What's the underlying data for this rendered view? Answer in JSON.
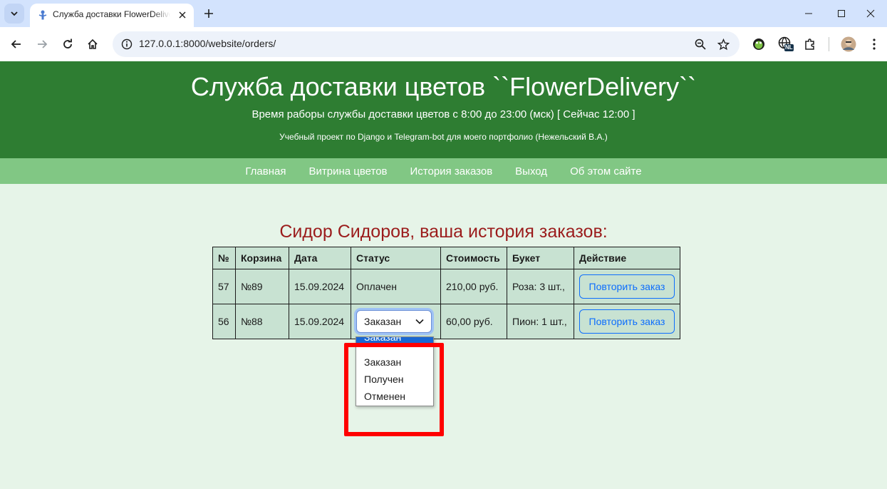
{
  "browser": {
    "tab_title": "Служба доставки FlowerDelivery",
    "url": "127.0.0.1:8000/website/orders/",
    "extension_badge": "NL"
  },
  "header": {
    "title": "Служба доставки цветов ``FlowerDelivery``",
    "hours": "Время раборы службы доставки цветов с 8:00 до 23:00 (мск) [ Сейчас 12:00 ]",
    "note": "Учебный проект по Django и Telegram-bot для моего портфолио (Нежельский В.А.)"
  },
  "nav": {
    "items": [
      "Главная",
      "Витрина цветов",
      "История заказов",
      "Выход",
      "Об этом сайте"
    ]
  },
  "orders": {
    "heading": "Сидор Сидоров, ваша история заказов:",
    "columns": [
      "№",
      "Корзина",
      "Дата",
      "Статус",
      "Стоимость",
      "Букет",
      "Действие"
    ],
    "rows": [
      {
        "num": "57",
        "cart": "№89",
        "date": "15.09.2024",
        "status": "Оплачен",
        "cost": "210,00 руб.",
        "bouquet": "Роза: 3 шт.,",
        "action": "Повторить заказ"
      },
      {
        "num": "56",
        "cart": "№88",
        "date": "15.09.2024",
        "status": "Заказан",
        "cost": "60,00 руб.",
        "bouquet": "Пион: 1 шт.,",
        "action": "Повторить заказ"
      }
    ]
  },
  "status_dropdown": {
    "selected": "Заказан",
    "options": [
      "Заказан",
      "Заказан",
      "Получен",
      "Отменен"
    ]
  },
  "colors": {
    "header_bg": "#2e7d32",
    "nav_bg": "#81c784",
    "page_bg": "#e6f4e8",
    "heading": "#9b1c1c",
    "highlight": "#ff0000",
    "button_accent": "#0d6efd"
  }
}
